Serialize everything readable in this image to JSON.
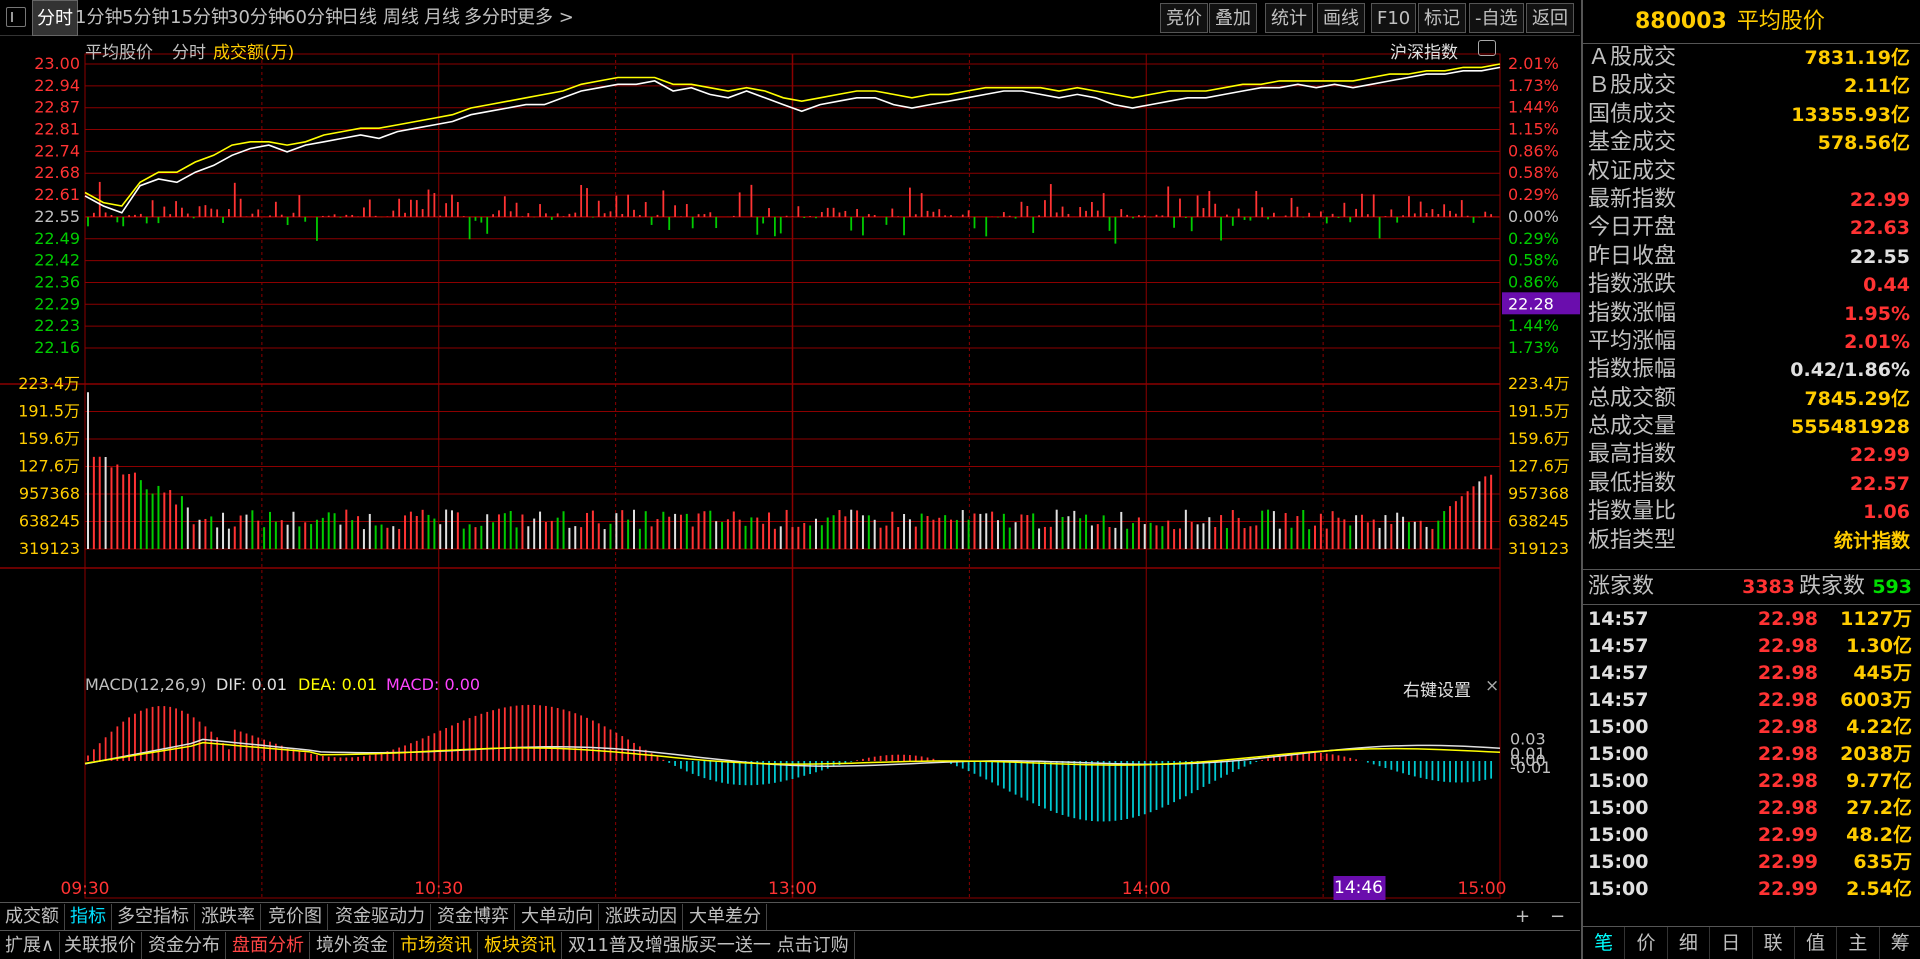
{
  "toolbar": {
    "items": [
      "分时",
      "1分钟",
      "5分钟",
      "15分钟",
      "30分钟",
      "60分钟",
      "日线",
      "周线",
      "月线",
      "多分时",
      "更多 >"
    ],
    "right": [
      "竞价",
      "叠加",
      "统计",
      "画线",
      "F10",
      "标记",
      "-自选",
      "返回"
    ]
  },
  "chart_header": {
    "name": "平均股价",
    "mode": "分时",
    "amount": "成交额(万)",
    "index_button": "沪深指数"
  },
  "price_axis": {
    "left": [
      "23.00",
      "22.94",
      "22.87",
      "22.81",
      "22.74",
      "22.68",
      "22.61",
      "22.55",
      "22.49",
      "22.42",
      "22.36",
      "22.29",
      "22.23",
      "22.16"
    ],
    "right": [
      "2.01%",
      "1.73%",
      "1.44%",
      "1.15%",
      "0.86%",
      "0.58%",
      "0.29%",
      "0.00%",
      "0.29%",
      "0.58%",
      "0.86%",
      "1.15%",
      "1.44%",
      "1.73%"
    ],
    "cursor_price": "22.28"
  },
  "volume_axis": {
    "labels": [
      "223.4万",
      "191.5万",
      "159.6万",
      "127.6万",
      "957368",
      "638245",
      "319123"
    ]
  },
  "macd": {
    "title": "MACD(12,26,9)",
    "dif": "DIF: 0.01",
    "dea": "DEA: 0.01",
    "macd": "MACD: 0.00",
    "setting": "右键设置",
    "close": "×",
    "axis": [
      "0.03",
      "0.01",
      "0.00",
      "-0.01"
    ]
  },
  "time_axis": {
    "labels": [
      "09:30",
      "10:30",
      "13:00",
      "14:00",
      "15:00"
    ],
    "cursor_time": "14:46"
  },
  "chart_data": {
    "type": "line",
    "title": "平均股价",
    "series": [
      {
        "name": "平均股价",
        "color": "#ffffff",
        "values": [
          22.61,
          22.58,
          22.56,
          22.64,
          22.66,
          22.65,
          22.68,
          22.7,
          22.73,
          22.75,
          22.76,
          22.74,
          22.76,
          22.77,
          22.78,
          22.79,
          22.78,
          22.8,
          22.81,
          22.82,
          22.83,
          22.85,
          22.86,
          22.87,
          22.88,
          22.88,
          22.9,
          22.92,
          22.93,
          22.94,
          22.94,
          22.95,
          22.92,
          22.93,
          22.91,
          22.9,
          22.92,
          22.9,
          22.88,
          22.86,
          22.88,
          22.89,
          22.9,
          22.9,
          22.88,
          22.87,
          22.88,
          22.89,
          22.9,
          22.91,
          22.92,
          22.92,
          22.91,
          22.9,
          22.91,
          22.9,
          22.88,
          22.87,
          22.88,
          22.89,
          22.9,
          22.9,
          22.91,
          22.92,
          22.93,
          22.93,
          22.94,
          22.93,
          22.94,
          22.93,
          22.94,
          22.95,
          22.96,
          22.97,
          22.97,
          22.98,
          22.98,
          22.99
        ]
      },
      {
        "name": "成交额均线",
        "color": "#ffff00",
        "values": [
          22.62,
          22.59,
          22.58,
          22.65,
          22.68,
          22.68,
          22.71,
          22.73,
          22.76,
          22.77,
          22.77,
          22.76,
          22.77,
          22.79,
          22.8,
          22.81,
          22.81,
          22.82,
          22.83,
          22.84,
          22.85,
          22.87,
          22.88,
          22.89,
          22.9,
          22.91,
          22.92,
          22.94,
          22.95,
          22.96,
          22.96,
          22.96,
          22.94,
          22.94,
          22.93,
          22.92,
          22.93,
          22.92,
          22.9,
          22.89,
          22.9,
          22.91,
          22.92,
          22.92,
          22.91,
          22.9,
          22.91,
          22.91,
          22.92,
          22.93,
          22.93,
          22.93,
          22.93,
          22.92,
          22.93,
          22.92,
          22.91,
          22.9,
          22.91,
          22.92,
          22.92,
          22.92,
          22.93,
          22.94,
          22.94,
          22.95,
          22.95,
          22.95,
          22.95,
          22.95,
          22.96,
          22.97,
          22.97,
          22.98,
          22.98,
          22.99,
          22.99,
          23.0
        ]
      }
    ],
    "x_range": [
      "09:30",
      "15:00"
    ],
    "ylim": [
      22.16,
      23.0
    ]
  },
  "right_panel": {
    "code": "880003",
    "name": "平均股价",
    "stats": [
      {
        "label": "Ａ股成交",
        "value": "7831.19亿",
        "color": "#ffcc00"
      },
      {
        "label": "Ｂ股成交",
        "value": "2.11亿",
        "color": "#ffcc00"
      },
      {
        "label": "国债成交",
        "value": "13355.93亿",
        "color": "#ffcc00"
      },
      {
        "label": "基金成交",
        "value": "578.56亿",
        "color": "#ffcc00"
      },
      {
        "label": "权证成交",
        "value": "",
        "color": "#ffcc00"
      },
      {
        "label": "最新指数",
        "value": "22.99",
        "color": "#ff3333"
      },
      {
        "label": "今日开盘",
        "value": "22.63",
        "color": "#ff3333"
      },
      {
        "label": "昨日收盘",
        "value": "22.55",
        "color": "#e0e0e0"
      },
      {
        "label": "指数涨跌",
        "value": "0.44",
        "color": "#ff3333"
      },
      {
        "label": "指数涨幅",
        "value": "1.95%",
        "color": "#ff3333"
      },
      {
        "label": "平均涨幅",
        "value": "2.01%",
        "color": "#ff3333"
      },
      {
        "label": "指数振幅",
        "value": "0.42/1.86%",
        "color": "#e0e0e0"
      },
      {
        "label": "总成交额",
        "value": "7845.29亿",
        "color": "#ffcc00"
      },
      {
        "label": "总成交量",
        "value": "555481928",
        "color": "#ffcc00"
      },
      {
        "label": "最高指数",
        "value": "22.99",
        "color": "#ff3333"
      },
      {
        "label": "最低指数",
        "value": "22.57",
        "color": "#ff3333"
      },
      {
        "label": "指数量比",
        "value": "1.06",
        "color": "#ff3333"
      },
      {
        "label": "板指类型",
        "value": "统计指数",
        "color": "#ffcc00"
      }
    ],
    "up_label": "涨家数",
    "up_value": "3383",
    "down_label": "跌家数",
    "down_value": "593",
    "ticks": [
      {
        "t": "14:57",
        "p": "22.98",
        "v": "1127万"
      },
      {
        "t": "14:57",
        "p": "22.98",
        "v": "1.30亿"
      },
      {
        "t": "14:57",
        "p": "22.98",
        "v": "445万"
      },
      {
        "t": "14:57",
        "p": "22.98",
        "v": "6003万"
      },
      {
        "t": "15:00",
        "p": "22.98",
        "v": "4.22亿"
      },
      {
        "t": "15:00",
        "p": "22.98",
        "v": "2038万"
      },
      {
        "t": "15:00",
        "p": "22.98",
        "v": "9.77亿"
      },
      {
        "t": "15:00",
        "p": "22.98",
        "v": "27.2亿"
      },
      {
        "t": "15:00",
        "p": "22.99",
        "v": "48.2亿"
      },
      {
        "t": "15:00",
        "p": "22.99",
        "v": "635万"
      },
      {
        "t": "15:00",
        "p": "22.99",
        "v": "2.54亿"
      }
    ],
    "tabs": [
      "笔",
      "价",
      "细",
      "日",
      "联",
      "值",
      "主",
      "筹"
    ]
  },
  "indicator_tabs": [
    "成交额",
    "指标",
    "多空指标",
    "涨跌率",
    "竞价图",
    "资金驱动力",
    "资金博弈",
    "大单动向",
    "涨跌动因",
    "大单差分"
  ],
  "indicator_controls": [
    "+",
    "−"
  ],
  "bottom_bar": [
    {
      "label": "扩展∧",
      "style": ""
    },
    {
      "label": "关联报价",
      "style": ""
    },
    {
      "label": "资金分布",
      "style": ""
    },
    {
      "label": "盘面分析",
      "style": "red"
    },
    {
      "label": "境外资金",
      "style": ""
    },
    {
      "label": "市场资讯",
      "style": "yel"
    },
    {
      "label": "板块资讯",
      "style": "yel"
    },
    {
      "label": "双11普及增强版买一送一 点击订购",
      "style": ""
    }
  ],
  "colors": {
    "up": "#ff3333",
    "down": "#00cc00",
    "grid": "#8b0000",
    "price_line": "#ffffff",
    "avg_line": "#ffff00",
    "macd_neg": "#00c8d0"
  }
}
